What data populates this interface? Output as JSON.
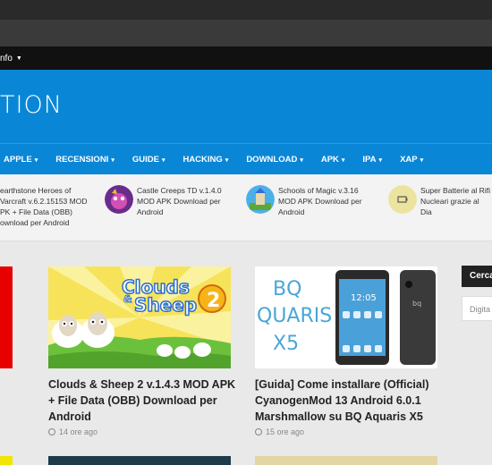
{
  "infobar": {
    "label": "nfo"
  },
  "header": {
    "logo_text": "TION"
  },
  "nav": {
    "items": [
      {
        "label": "APPLE"
      },
      {
        "label": "RECENSIONI"
      },
      {
        "label": "GUIDE"
      },
      {
        "label": "HACKING"
      },
      {
        "label": "DOWNLOAD"
      },
      {
        "label": "APK"
      },
      {
        "label": "IPA"
      },
      {
        "label": "XAP"
      }
    ]
  },
  "ticker": {
    "items": [
      {
        "lines": [
          "earthstone Heroes of",
          "Varcraft v.6.2.15153 MOD",
          "PK + File Data (OBB)",
          "ownload per Android"
        ]
      },
      {
        "lines": [
          "Castle Creeps TD v.1.4.0",
          "MOD APK Download per",
          "Android"
        ]
      },
      {
        "lines": [
          "Schools of Magic v.3.16",
          "MOD APK Download per",
          "Android"
        ]
      },
      {
        "lines": [
          "Super Batterie al Rifi",
          "Nucleari grazie al Dia"
        ]
      }
    ]
  },
  "cards": [
    {
      "title_lines": [
        "Clouds & Sheep 2 v.1.4.3 MOD APK",
        "+ File Data (OBB) Download per",
        "Android"
      ],
      "time": "14 ore ago",
      "image_text_1": "Clouds",
      "image_text_2": "&",
      "image_text_3": "Sheep",
      "image_badge": "2"
    },
    {
      "title_lines": [
        "[Guida] Come installare (Official)",
        "CyanogenMod 13 Android 6.0.1",
        "Marshmallow su BQ Aquaris X5"
      ],
      "time": "15 ore ago",
      "image_text_1": "BQ",
      "image_text_2": "QUARIS",
      "image_text_3": "X5",
      "phone_time": "12:05",
      "phone_brand": "bq"
    }
  ],
  "sidebar": {
    "title": "Cerca",
    "search_placeholder": "Digita"
  }
}
